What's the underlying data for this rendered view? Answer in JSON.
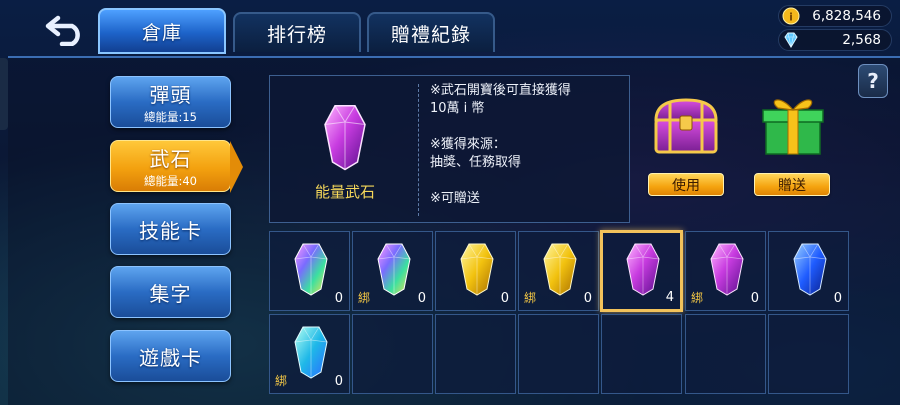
{
  "tabs": [
    {
      "label": "倉庫",
      "active": true
    },
    {
      "label": "排行榜",
      "active": false
    },
    {
      "label": "贈禮紀錄",
      "active": false
    }
  ],
  "currency": {
    "coins": "6,828,546",
    "gems": "2,568",
    "coin_icon": "coin-icon",
    "gem_icon": "diamond-icon"
  },
  "help_label": "?",
  "sidebar": {
    "items": [
      {
        "label": "彈頭",
        "sub": "總能量:15",
        "active": false
      },
      {
        "label": "武石",
        "sub": "總能量:40",
        "active": true
      },
      {
        "label": "技能卡",
        "sub": "",
        "active": false
      },
      {
        "label": "集字",
        "sub": "",
        "active": false
      },
      {
        "label": "遊戲卡",
        "sub": "",
        "active": false
      }
    ]
  },
  "detail": {
    "name": "能量武石",
    "lines": [
      "※武石開寶後可直接獲得",
      "10萬 i 幣",
      "",
      "※獲得來源：",
      "抽獎、任務取得",
      "",
      "※可贈送"
    ]
  },
  "actions": {
    "use_label": "使用",
    "gift_label": "贈送"
  },
  "items": [
    {
      "gem": "rainbow",
      "bound": false,
      "qty": "0"
    },
    {
      "gem": "rainbow",
      "bound": true,
      "qty": "0"
    },
    {
      "gem": "gold",
      "bound": false,
      "qty": "0"
    },
    {
      "gem": "gold",
      "bound": true,
      "qty": "0"
    },
    {
      "gem": "purple",
      "bound": false,
      "qty": "4",
      "selected": true
    },
    {
      "gem": "purple",
      "bound": true,
      "qty": "0"
    },
    {
      "gem": "blue",
      "bound": false,
      "qty": "0"
    },
    {
      "gem": "cyan",
      "bound": true,
      "qty": "0"
    }
  ],
  "bind_label": "綁",
  "colors": {
    "accent_blue": "#1d63c9",
    "accent_gold": "#f5a40f",
    "detail_name": "#f5d75a",
    "bind_text": "#f5c845"
  }
}
